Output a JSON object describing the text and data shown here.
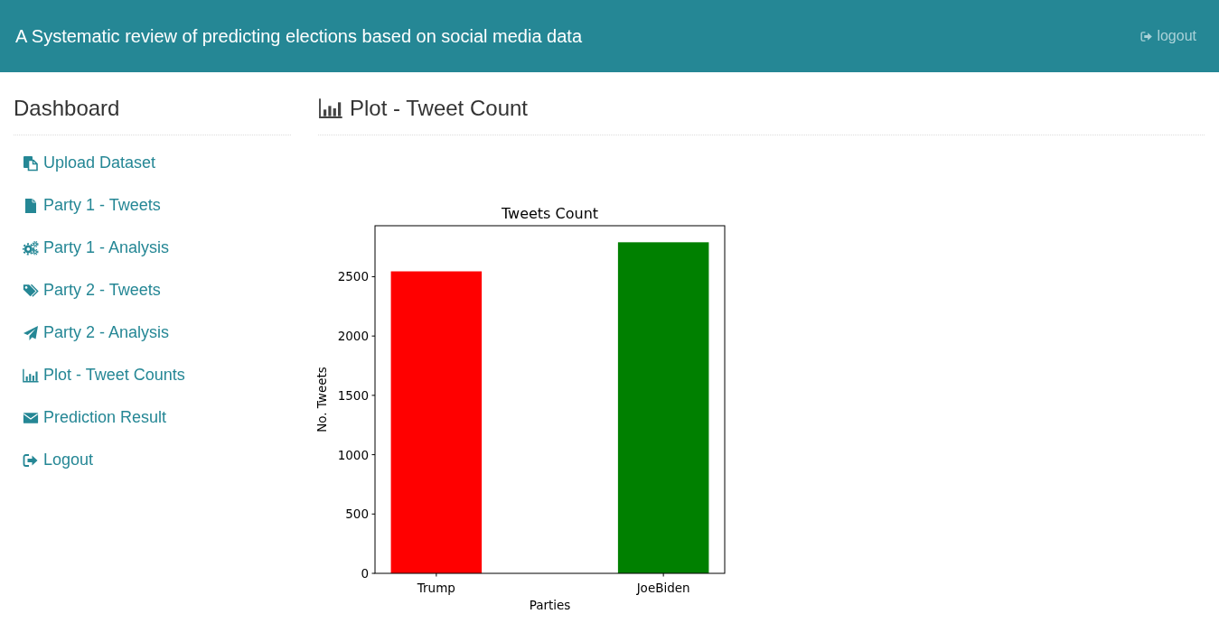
{
  "header": {
    "title": "A Systematic review of predicting elections based on social media data",
    "logout_link": "logout"
  },
  "sidebar": {
    "title": "Dashboard",
    "items": [
      "Upload Dataset",
      "Party 1 - Tweets",
      "Party 1 - Analysis",
      "Party 2 - Tweets",
      "Party 2 - Analysis",
      "Plot - Tweet Counts",
      "Prediction Result",
      "Logout"
    ]
  },
  "main": {
    "heading": "Plot - Tweet Count",
    "chart_data": {
      "type": "bar",
      "title": "Tweets Count",
      "xlabel": "Parties",
      "ylabel": "No. Tweets",
      "categories": [
        "Trump",
        "JoeBiden"
      ],
      "series": [
        {
          "color": "#ff0000",
          "values": [
            2545,
            null
          ]
        },
        {
          "color": "#008000",
          "values": [
            null,
            2790
          ]
        }
      ],
      "ylim": [
        0,
        2929.5
      ],
      "yticks": [
        0,
        500,
        1000,
        1500,
        2000,
        2500
      ]
    }
  }
}
